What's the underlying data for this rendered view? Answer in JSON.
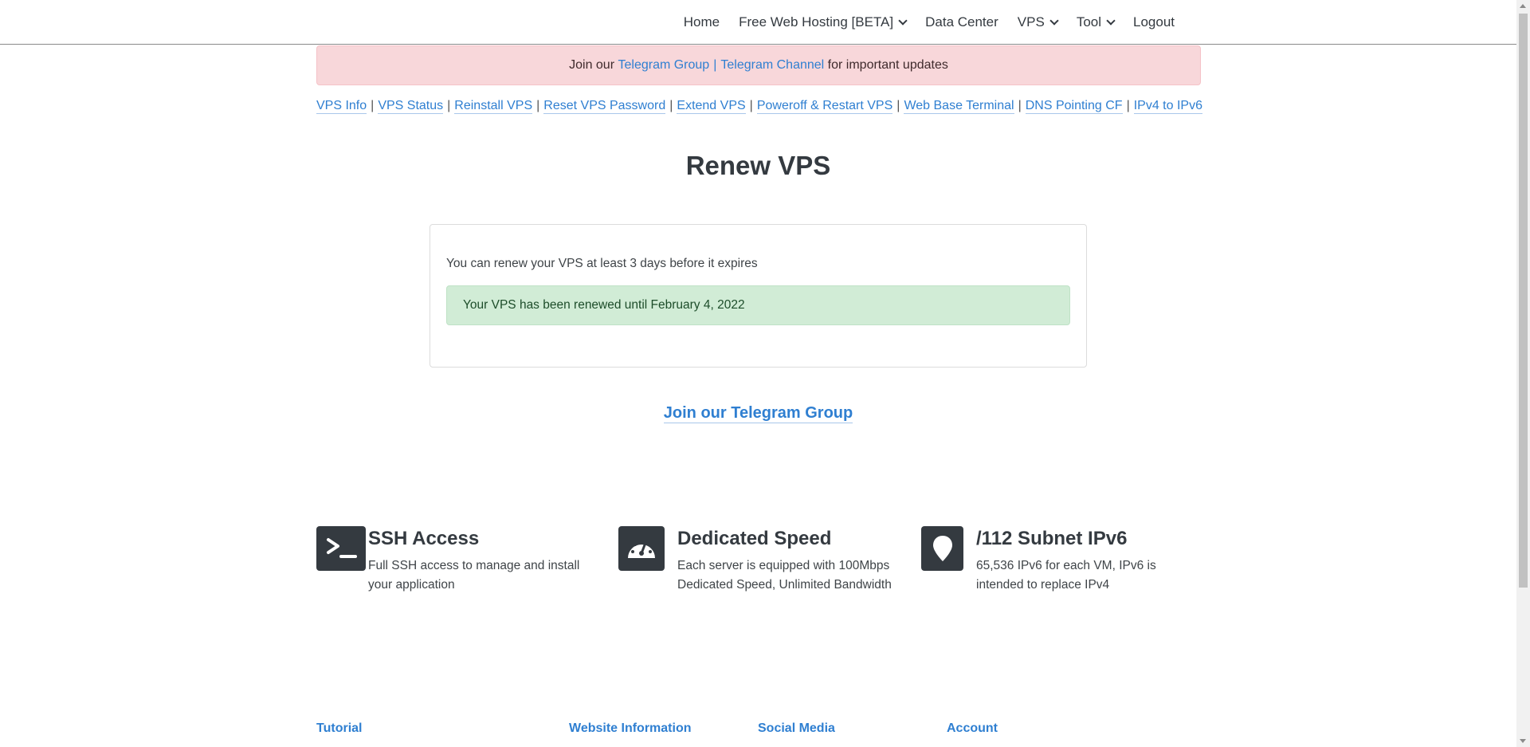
{
  "navbar": {
    "items": [
      {
        "label": "Home",
        "dropdown": false
      },
      {
        "label": "Free Web Hosting [BETA]",
        "dropdown": true
      },
      {
        "label": "Data Center",
        "dropdown": false
      },
      {
        "label": "VPS",
        "dropdown": true
      },
      {
        "label": "Tool",
        "dropdown": true
      },
      {
        "label": "Logout",
        "dropdown": false
      }
    ]
  },
  "banner": {
    "prefix": "Join our",
    "link1": "Telegram Group",
    "separator": "|",
    "link2": "Telegram Channel",
    "suffix": "for important updates"
  },
  "subnav": {
    "links": [
      "VPS Info",
      "VPS Status",
      "Reinstall VPS",
      "Reset VPS Password",
      "Extend VPS",
      "Poweroff & Restart VPS",
      "Web Base Terminal",
      "DNS Pointing CF",
      "IPv4 to IPv6"
    ],
    "separator": "|"
  },
  "page": {
    "title": "Renew VPS"
  },
  "card": {
    "info": "You can renew your VPS at least 3 days before it expires",
    "success": "Your VPS has been renewed until February 4, 2022"
  },
  "telegram_link": "Join our Telegram Group",
  "features": [
    {
      "icon": "terminal-icon",
      "title": "SSH Access",
      "desc1": "Full SSH access to manage and install",
      "desc2": "your application"
    },
    {
      "icon": "speedometer-icon",
      "title": "Dedicated Speed",
      "desc1": "Each server is equipped with 100Mbps",
      "desc2": "Dedicated Speed, Unlimited Bandwidth"
    },
    {
      "icon": "map-pin-icon",
      "title": "/112 Subnet IPv6",
      "desc1": "65,536 IPv6 for each VM, IPv6 is",
      "desc2": "intended to replace IPv4"
    }
  ],
  "footer": {
    "headings": [
      "Tutorial",
      "Website Information",
      "Social Media",
      "Account"
    ]
  },
  "colors": {
    "link": "#2f7fd1",
    "banner_bg": "#f8d7da",
    "success_bg": "#d1ecd6",
    "icon_bg": "#343a40"
  }
}
